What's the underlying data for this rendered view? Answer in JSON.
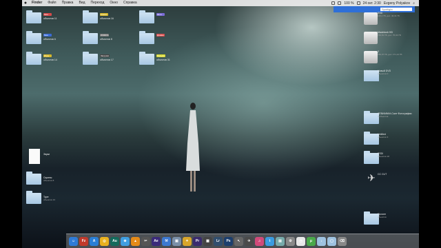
{
  "menubar": {
    "items": [
      "Finder",
      "Файл",
      "Правка",
      "Вид",
      "Переход",
      "Окно",
      "Справка"
    ],
    "status_text": "24 окт. 2:30",
    "user": "Evgeny Polyakov",
    "zoom": "100 %"
  },
  "spotlight": {
    "placeholder": "Spotlight"
  },
  "desktop_left": [
    {
      "tag": "Мои",
      "label": "объектов 11",
      "sub": "",
      "tag_color": "#d74a4a"
    },
    {
      "tag": "Ключи",
      "label": "объектов 16",
      "sub": "",
      "tag_color": "#d8b82a"
    },
    {
      "tag": "Фото",
      "label": "",
      "sub": "",
      "tag_color": "#7b6bd6"
    },
    {
      "tag": "Моё",
      "label": "объектов 6",
      "sub": "",
      "tag_color": "#3a6bd6"
    },
    {
      "tag": "WORKS",
      "label": "объектов 8",
      "sub": "",
      "tag_color": "#777"
    },
    {
      "tag": "Домаш",
      "label": "",
      "sub": "",
      "tag_color": "#d74a4a"
    },
    {
      "tag": "Игры",
      "label": "объектов 14",
      "sub": "",
      "tag_color": "#d8b82a"
    },
    {
      "tag": "Загрузки",
      "label": "объектов 17",
      "sub": "",
      "tag_color": "#444"
    },
    {
      "tag": "Музыка",
      "label": "объектов 31",
      "sub": "",
      "tag_color": "#d8d82a"
    }
  ],
  "desktop_lower": [
    {
      "label": "Звуки",
      "sub": "",
      "kind": "doc"
    },
    {
      "label": "Скрины",
      "sub": "объектов 8",
      "kind": "folder"
    },
    {
      "label": "Туре",
      "sub": "объектов 13",
      "kind": "folder"
    }
  ],
  "desktop_right": [
    {
      "label": "SSD",
      "sub": "119,1 ГБ, дос. 40,31 ГБ",
      "kind": "drive"
    },
    {
      "label": "Macintosh HD",
      "sub": "749,81 ГБ, дос. 76,04 ГБ",
      "kind": "drive"
    },
    {
      "label": "2",
      "sub": "750,07 ГБ, дос. 171,21 ГБ",
      "kind": "drive"
    },
    {
      "label": "Новый DVD",
      "sub": "объектов 0",
      "kind": "dvd"
    },
    {
      "label": "ЛЕВИАФАН-Салт Фотографии",
      "sub": "4 объектов",
      "kind": "folder"
    },
    {
      "label": "Untitled",
      "sub": "объектов 3",
      "kind": "folder"
    },
    {
      "label": "PSDI",
      "sub": "объектов 18",
      "kind": "folder"
    },
    {
      "label": "CC CUT",
      "sub": "",
      "kind": "ccs"
    },
    {
      "label": "Прочее",
      "sub": "объектов",
      "kind": "folder"
    }
  ],
  "dock": [
    {
      "name": "finder-icon",
      "glyph": "☺",
      "color": "#2f7bd6"
    },
    {
      "name": "filezilla-icon",
      "glyph": "Fz",
      "color": "#c0392b"
    },
    {
      "name": "app-store-icon",
      "glyph": "A",
      "color": "#2a7fd6"
    },
    {
      "name": "chrome-icon",
      "glyph": "◎",
      "color": "#e9b11f"
    },
    {
      "name": "audition-icon",
      "glyph": "Au",
      "color": "#146b5c"
    },
    {
      "name": "safari-icon",
      "glyph": "⊕",
      "color": "#3f9ee0"
    },
    {
      "name": "vlc-icon",
      "glyph": "▲",
      "color": "#e48a18"
    },
    {
      "name": "finalcut-icon",
      "glyph": "✂",
      "color": "#555"
    },
    {
      "name": "aftereffects-icon",
      "glyph": "Ae",
      "color": "#3b2a7a"
    },
    {
      "name": "xcode-icon",
      "glyph": "⚒",
      "color": "#3d78d0"
    },
    {
      "name": "mac-icon",
      "glyph": "▣",
      "color": "#7a8fa8"
    },
    {
      "name": "tools-icon",
      "glyph": "✦",
      "color": "#d8a52a"
    },
    {
      "name": "premiere-icon",
      "glyph": "Pr",
      "color": "#3a2b6e"
    },
    {
      "name": "clapper-icon",
      "glyph": "▦",
      "color": "#444"
    },
    {
      "name": "lightroom-icon",
      "glyph": "Lr",
      "color": "#314e6e"
    },
    {
      "name": "photoshop-icon",
      "glyph": "Ps",
      "color": "#1c3e6d"
    },
    {
      "name": "cursor-icon",
      "glyph": "↖",
      "color": "#666"
    },
    {
      "name": "launchpad-icon",
      "glyph": "✈",
      "color": "#4a4a4a"
    },
    {
      "name": "itunes-icon",
      "glyph": "♫",
      "color": "#d04a7a"
    },
    {
      "name": "twitter-icon",
      "glyph": "t",
      "color": "#3a9be0"
    },
    {
      "name": "preview-icon",
      "glyph": "▤",
      "color": "#7aa"
    },
    {
      "name": "prefs-icon",
      "glyph": "⚙",
      "color": "#888"
    },
    {
      "name": "clock-icon",
      "glyph": "◷",
      "color": "#e8e8e8"
    },
    {
      "name": "utorrent-icon",
      "glyph": "µ",
      "color": "#4aa84a"
    },
    {
      "name": "downloads-icon",
      "glyph": "↓",
      "color": "#9ec2e0"
    },
    {
      "name": "docs-icon",
      "glyph": "▢",
      "color": "#9ec2e0"
    },
    {
      "name": "trash-icon",
      "glyph": "⌫",
      "color": "#888"
    }
  ]
}
